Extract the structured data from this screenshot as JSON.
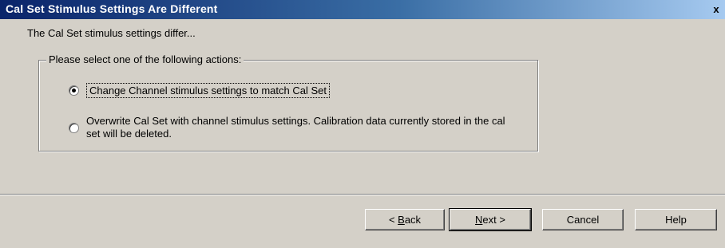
{
  "window": {
    "title": "Cal Set Stimulus Settings Are Different",
    "close_glyph": "x"
  },
  "intro_text": "The Cal Set stimulus settings differ...",
  "group": {
    "legend": "Please select one of the following actions:",
    "options": [
      {
        "label": "Change Channel stimulus settings to match Cal Set",
        "selected": true
      },
      {
        "label": "Overwrite Cal Set with channel stimulus settings.  Calibration data currently stored in the cal set will be deleted.",
        "selected": false
      }
    ]
  },
  "buttons": {
    "back": {
      "prefix": "< ",
      "mnemonic": "B",
      "rest": "ack"
    },
    "next": {
      "mnemonic": "N",
      "rest": "ext >"
    },
    "cancel": "Cancel",
    "help": "Help"
  }
}
